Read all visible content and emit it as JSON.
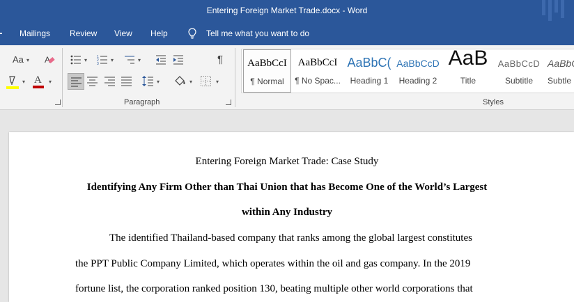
{
  "window": {
    "title": "Entering Foreign Market Trade.docx",
    "separator": " - ",
    "app": "Word"
  },
  "menu": {
    "items": [
      "Mailings",
      "Review",
      "View",
      "Help"
    ],
    "tell_me": "Tell me what you want to do"
  },
  "ribbon": {
    "paragraph_label": "Paragraph",
    "styles_label": "Styles",
    "font_size_glyph": "Aa",
    "font_color_glyph": "A",
    "pilcrow_glyph": "¶",
    "styles": [
      {
        "preview": "AaBbCcI",
        "name": "¶ Normal"
      },
      {
        "preview": "AaBbCcI",
        "name": "¶ No Spac..."
      },
      {
        "preview": "AaBbC(",
        "name": "Heading 1"
      },
      {
        "preview": "AaBbCcD",
        "name": "Heading 2"
      },
      {
        "preview": "AaB",
        "name": "Title"
      },
      {
        "preview": "AaBbCcD",
        "name": "Subtitle"
      },
      {
        "preview": "AaBbC",
        "name": "Subtle E"
      }
    ],
    "colors": {
      "highlight": "#ffff00",
      "font_color": "#c00000",
      "accent": "#2b579a"
    }
  },
  "document": {
    "title": "Entering Foreign Market Trade: Case Study",
    "heading_line1": "Identifying Any Firm Other than Thai Union that has Become One of the World’s Largest",
    "heading_line2": "within Any Industry",
    "body_lines": [
      "The identified Thailand-based company that ranks among the global largest constitutes",
      "the PPT Public Company Limited, which operates within the oil and gas company. In the 2019",
      "fortune list, the corporation ranked position 130, beating multiple other world corporations that"
    ]
  }
}
